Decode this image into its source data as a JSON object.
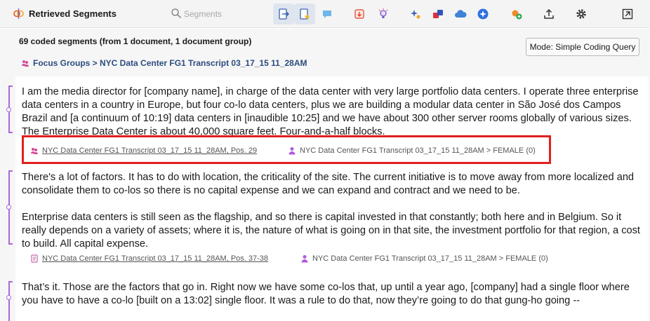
{
  "app": {
    "title": "Retrieved Segments"
  },
  "search": {
    "placeholder": "Segments"
  },
  "summary": "69 coded segments (from 1 document, 1 document group)",
  "mode_button": "Mode: Simple Coding Query",
  "document_group": "Focus Groups > NYC Data Center FG1 Transcript 03_17_15 11_28AM",
  "segments": [
    {
      "text": "I am the media director for [company name], in charge of the data center with very large portfolio data centers.  I operate three enterprise data centers in a country in Europe, but four co-lo data centers, plus we are building a modular data center in São José dos Campos Brazil and [a continuum of 10:19] data centers in [inaudible 10:25] and we have about 300 other server rooms globally of various sizes.  The Enterprise Data Center is about 40,000 square feet.  Four-and-a-half blocks.",
      "source": "NYC Data Center FG1 Transcript 03_17_15 11_28AM, Pos. 29",
      "code": "NYC Data Center FG1 Transcript 03_17_15 11_28AM > FEMALE (0)"
    },
    {
      "text": "There's a lot of factors.  It has to do with location, the criticality of the site.  The current initiative is to move away from more localized and consolidate them to co-los so there is no capital expense and we can expand and contract and we need to be.\n\nEnterprise data centers is still seen as the flagship, and so there is capital invested in that constantly; both here and in Belgium.  So it really depends on a variety of assets; where it is, the nature of what is going on in that site, the investment portfolio for that region, a cost to build.  All capital expense.",
      "source": "NYC Data Center FG1 Transcript 03_17_15 11_28AM, Pos. 37-38",
      "code": "NYC Data Center FG1 Transcript 03_17_15 11_28AM > FEMALE (0)"
    },
    {
      "text": "That’s it.  Those are the factors that go in.  Right now we have some co-los that, up until a year ago, [company] had a single floor where you have to have a co-lo [built on a 13:02] single floor.  It was a rule to do that, now they’re going to do that gung-ho going --"
    }
  ],
  "colors": {
    "accent": "#2b4c7e",
    "segment_bar": "#a869d8",
    "highlight": "#e0201f"
  }
}
